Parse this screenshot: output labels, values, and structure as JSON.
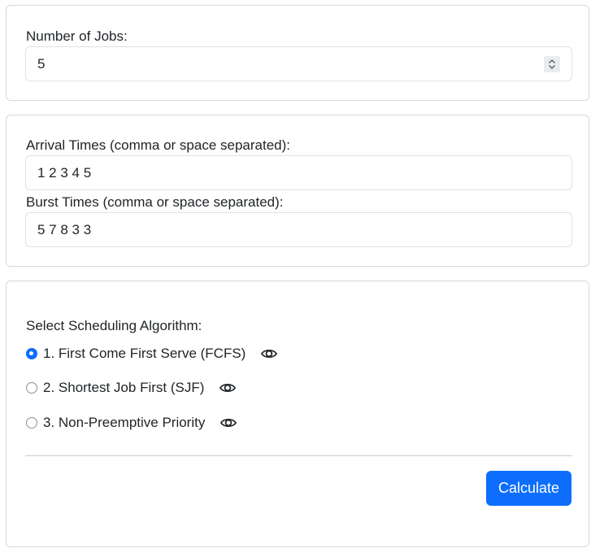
{
  "jobs": {
    "label": "Number of Jobs:",
    "value": "5"
  },
  "times": {
    "arrival_label": "Arrival Times (comma or space separated):",
    "arrival_value": "1 2 3 4 5",
    "burst_label": "Burst Times (comma or space separated):",
    "burst_value": "5 7 8 3 3"
  },
  "algorithm": {
    "label": "Select Scheduling Algorithm:",
    "options": [
      {
        "label": "1. First Come First Serve (FCFS)",
        "selected": true,
        "icon": "eye-icon"
      },
      {
        "label": "2. Shortest Job First (SJF)",
        "selected": false,
        "icon": "eye-icon"
      },
      {
        "label": "3. Non-Preemptive Priority",
        "selected": false,
        "icon": "eye-icon"
      }
    ],
    "button_label": "Calculate"
  },
  "colors": {
    "accent": "#0d6efd",
    "border": "#dee2e6",
    "text": "#212529"
  }
}
